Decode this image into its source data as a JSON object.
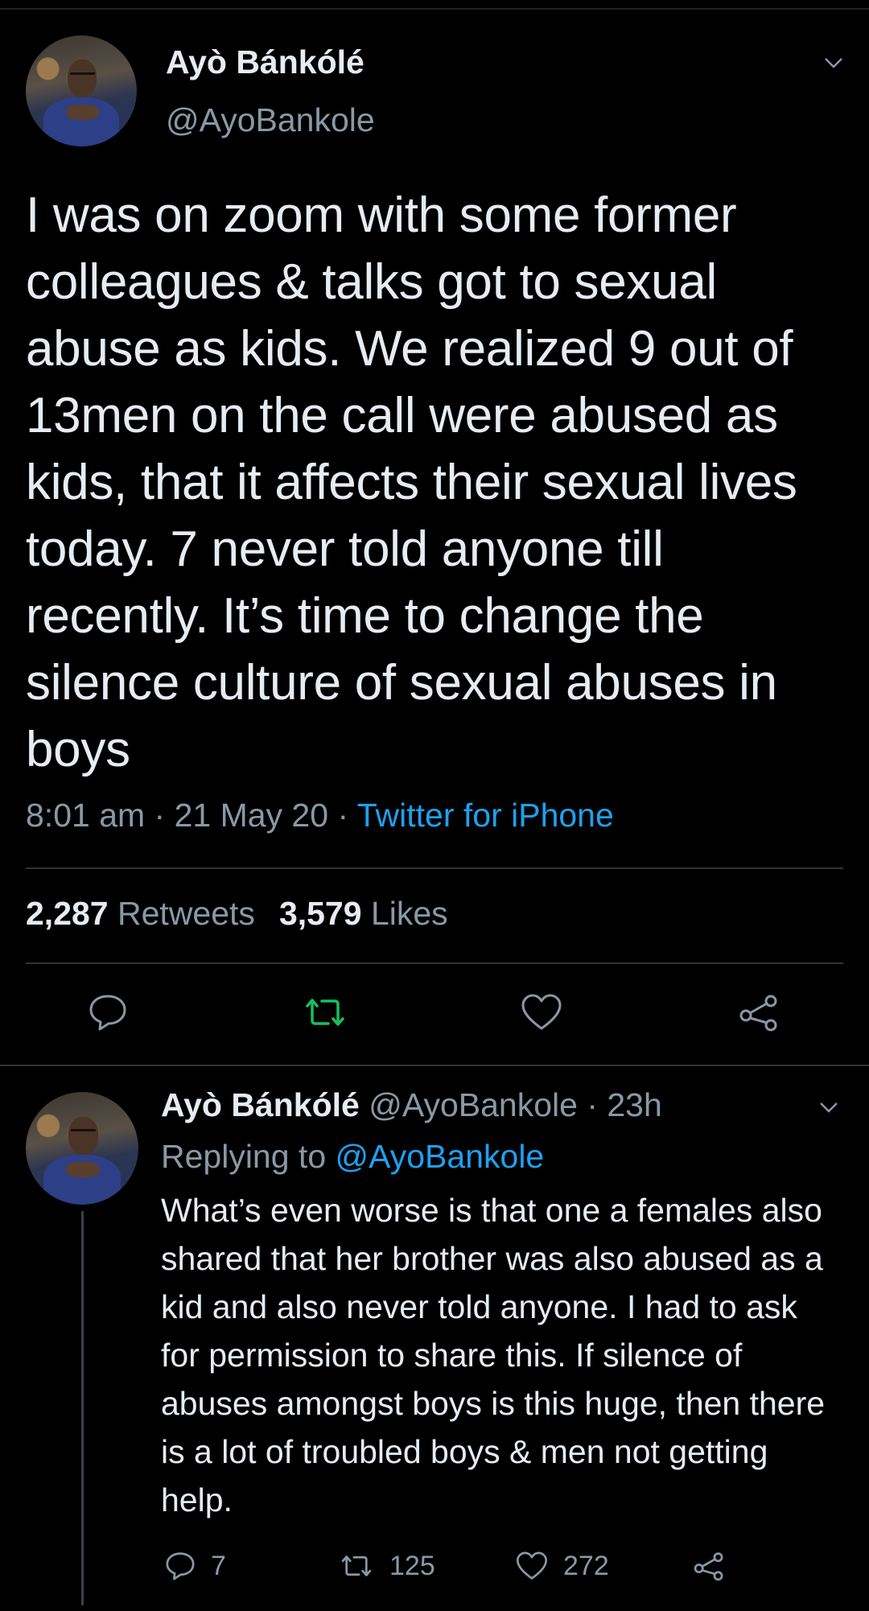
{
  "main_tweet": {
    "display_name": "Ayò Bánkólé",
    "handle": "@AyoBankole",
    "text": "I was on zoom with some former colleagues & talks got to sexual abuse as kids. We realized 9 out of 13men on the call were abused as kids, that it affects their sexual lives today. 7 never told anyone till recently. It’s time to change the silence culture of sexual abuses in boys",
    "time": "8:01 am",
    "date": "21 May 20",
    "separator": " · ",
    "source": "Twitter for iPhone",
    "retweets_count": "2,287",
    "retweets_label": "Retweets",
    "likes_count": "3,579",
    "likes_label": "Likes",
    "actions": {
      "reply_icon": "speech-bubble-icon",
      "retweet_icon": "retweet-icon",
      "like_icon": "heart-icon",
      "share_icon": "share-icon"
    }
  },
  "reply_tweet": {
    "display_name": "Ayò Bánkólé",
    "handle": "@AyoBankole",
    "time_ago": "23h",
    "separator": " · ",
    "replying_label": "Replying to",
    "replying_to": "@AyoBankole",
    "text": "What’s even worse is that one a females also shared that her brother was also abused as a kid and also never told anyone. I had to ask for permission to share this. If silence of abuses amongst boys is this huge, then there is a lot of troubled boys & men not getting help.",
    "reply_count": "7",
    "retweet_count": "125",
    "like_count": "272"
  },
  "colors": {
    "background": "#000000",
    "text_primary": "#e6ecf0",
    "text_secondary": "#8899a6",
    "link_blue": "#1da1f2",
    "retweet_green": "#17bf63",
    "divider": "#2f3336"
  }
}
